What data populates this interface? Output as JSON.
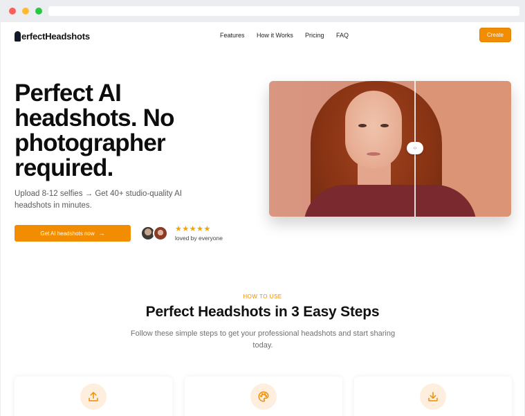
{
  "nav": {
    "logo_text": "erfectHeadshots",
    "links": [
      "Features",
      "How it Works",
      "Pricing",
      "FAQ"
    ],
    "create_label": "Create"
  },
  "hero": {
    "title": "Perfect AI headshots. No photographer required.",
    "subtitle": "Upload 8-12 selfies → Get 40+ studio-quality AI headshots in minutes.",
    "cta_label": "Get AI headshots now",
    "stars": "★★★★★",
    "social_proof": "loved by everyone",
    "compare_handle": "‹›"
  },
  "steps": {
    "eyebrow": "HOW TO USE",
    "title": "Perfect Headshots in 3 Easy Steps",
    "subtitle": "Follow these simple steps to get your professional headshots and start sharing today.",
    "cards": [
      {
        "icon": "upload-icon"
      },
      {
        "icon": "palette-icon"
      },
      {
        "icon": "download-icon"
      }
    ]
  },
  "colors": {
    "accent": "#f28c00",
    "icon_bg": "#fdeedd",
    "dark": "#111827"
  }
}
